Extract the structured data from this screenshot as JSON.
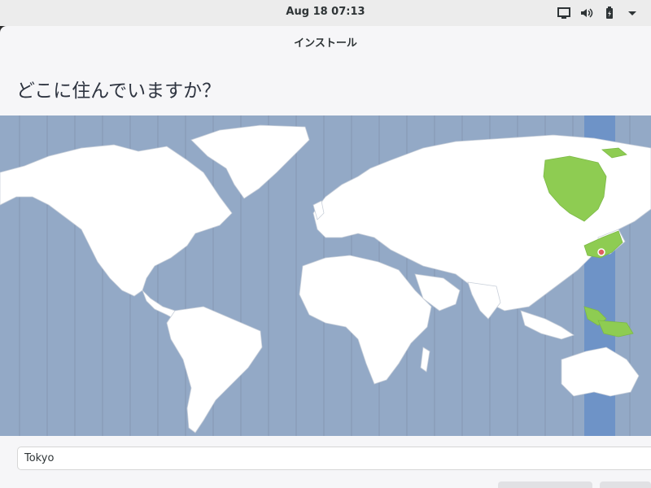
{
  "top_bar": {
    "clock": "Aug 18  07:13",
    "tray_icons": [
      "screen-icon",
      "volume-icon",
      "battery-icon",
      "chevron-down-icon"
    ]
  },
  "window": {
    "title": "インストール",
    "heading": "どこに住んでいますか？"
  },
  "map": {
    "selected_city": "Tokyo",
    "highlight_color": "#8ecc52",
    "selected_zone_color": "#6e93c7",
    "ocean_color": "#93a9c6",
    "land_color": "#ffffff"
  },
  "search": {
    "value": "Tokyo"
  }
}
